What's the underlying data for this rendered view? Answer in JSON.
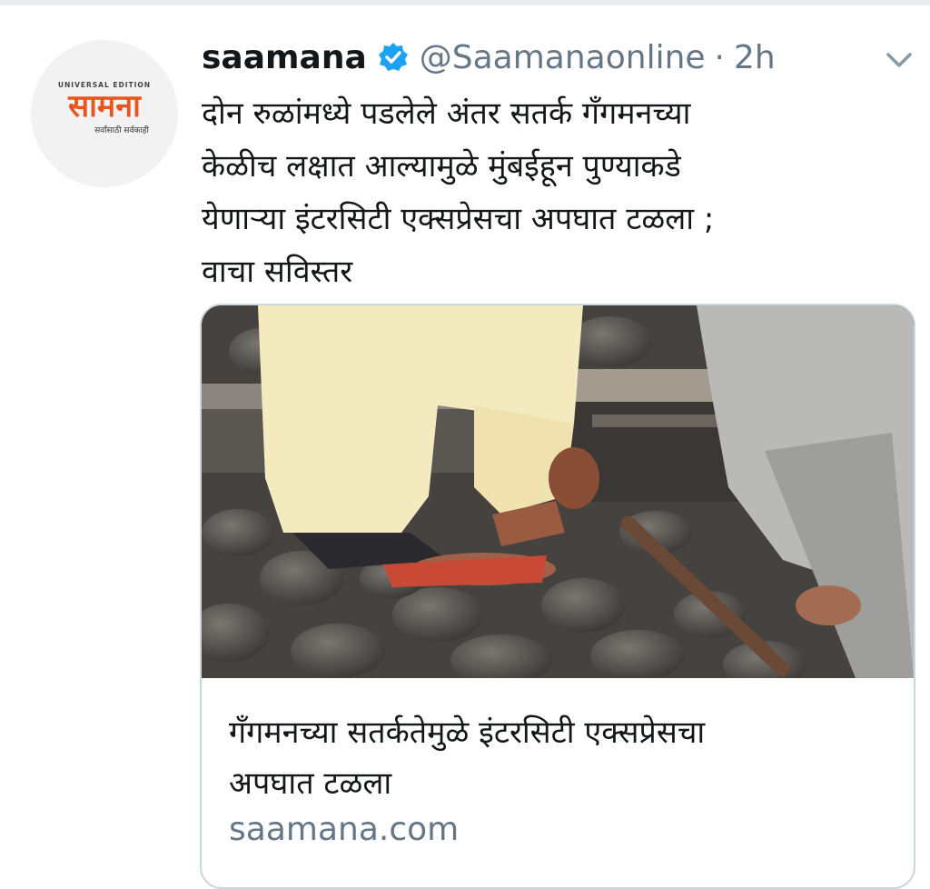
{
  "tweet": {
    "display_name": "saamana",
    "handle": "@Saamanaonline",
    "separator": "·",
    "time": "2h",
    "text_lines": [
      "दोन रुळांमध्ये पडलेले अंतर सतर्क गँगमनच्या",
      "केळीच लक्षात आल्यामुळे मुंबईहून पुण्याकडे",
      "येणाऱ्या इंटरसिटी एक्सप्रेसचा अपघात टळला ;",
      "वाचा सविस्तर"
    ],
    "avatar": {
      "top_text": "UNIVERSAL EDITION",
      "logo_text": "सामना",
      "tagline": "सर्वांसाठी सर्वकाही"
    },
    "icons": {
      "verified": "verified-badge-icon",
      "caret": "chevron-down-icon"
    }
  },
  "card": {
    "title_lines": [
      "गँगमनच्या सतर्कतेमुळे इंटरसिटी एक्सप्रेसचा",
      "अपघात टळला"
    ],
    "domain": "saamana.com"
  },
  "colors": {
    "text": "#14171a",
    "secondary": "#657786",
    "verified": "#1da1f2",
    "logo": "#e8561f",
    "border": "#ccd6dd"
  }
}
